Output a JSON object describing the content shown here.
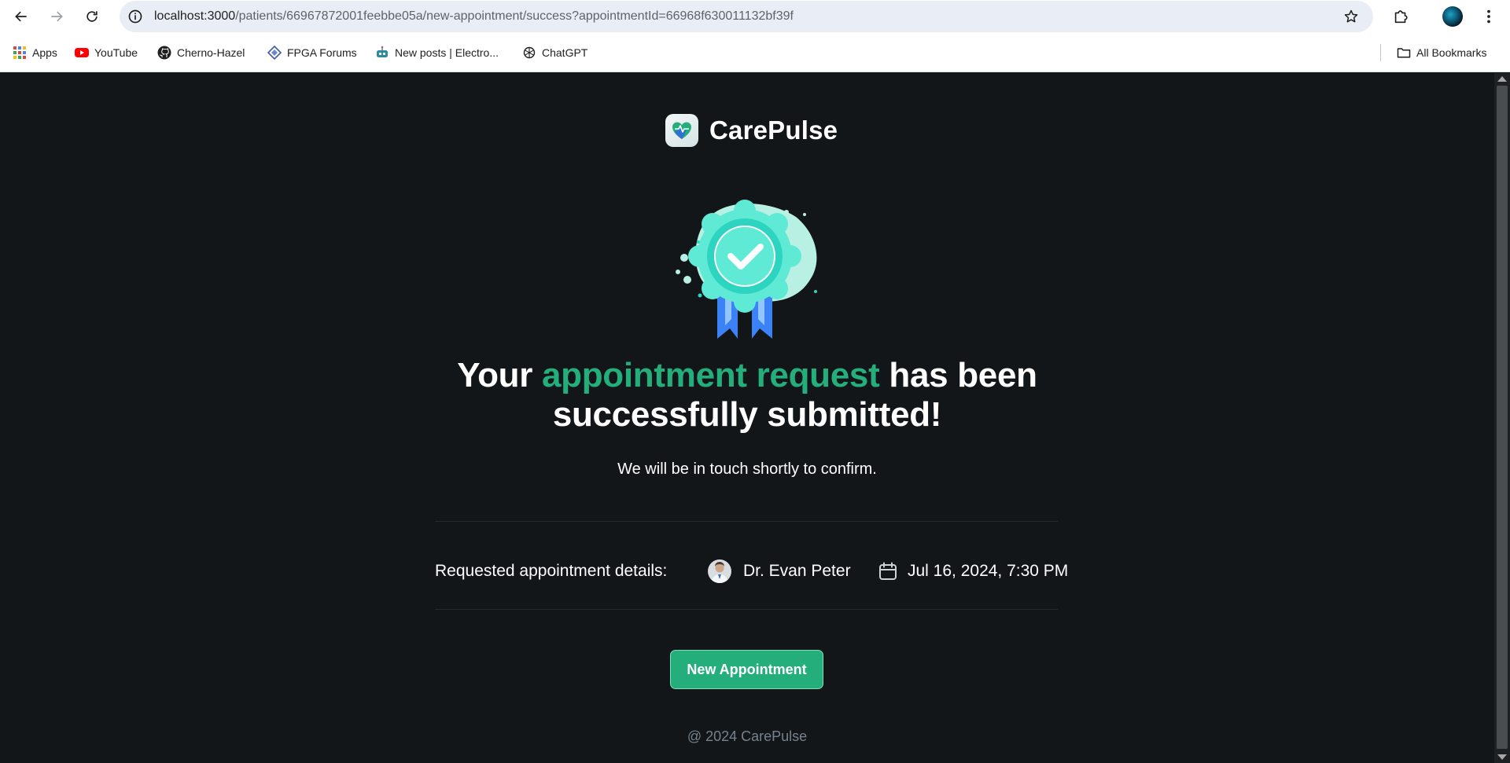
{
  "browser": {
    "url_host": "localhost:3000",
    "url_path": "/patients/66967872001feebbe05a/new-appointment/success?appointmentId=66968f630011132bf39f",
    "bookmarks": [
      {
        "label": "Apps",
        "icon": "apps-grid-icon"
      },
      {
        "label": "YouTube",
        "icon": "youtube-icon"
      },
      {
        "label": "Cherno-Hazel",
        "icon": "github-icon"
      },
      {
        "label": "FPGA Forums",
        "icon": "fpga-forums-icon"
      },
      {
        "label": "New posts | Electro...",
        "icon": "robot-icon"
      },
      {
        "label": "ChatGPT",
        "icon": "chatgpt-icon"
      }
    ],
    "all_bookmarks_label": "All Bookmarks"
  },
  "page": {
    "brand": "CarePulse",
    "headline": {
      "part1": "Your ",
      "highlight": "appointment request",
      "part2": " has been successfully submitted!"
    },
    "subtext": "We will be in touch shortly to confirm.",
    "details": {
      "label": "Requested appointment details:",
      "doctor": "Dr. Evan Peter",
      "datetime": "Jul 16, 2024, 7:30 PM"
    },
    "new_appointment_button": "New Appointment",
    "copyright": "@ 2024 CarePulse"
  },
  "colors": {
    "background": "#131619",
    "accent": "#24ae7c",
    "muted_text": "#76828d"
  }
}
